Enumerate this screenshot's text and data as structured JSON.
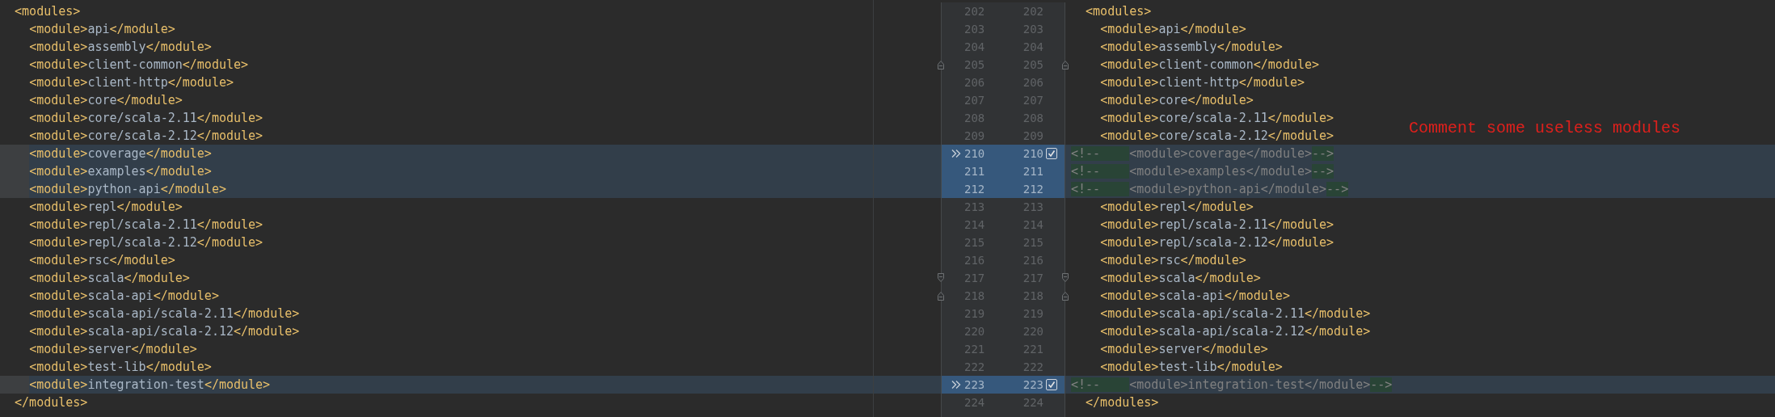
{
  "annotation": "Comment some useless modules",
  "lines": [
    {
      "left_number": "202",
      "right_number": "202",
      "left": "  <modules>",
      "right": "  <modules>",
      "changed": false
    },
    {
      "left_number": "203",
      "right_number": "203",
      "left": "    <module>api</module>",
      "right": "    <module>api</module>",
      "changed": false
    },
    {
      "left_number": "204",
      "right_number": "204",
      "left": "    <module>assembly</module>",
      "right": "    <module>assembly</module>",
      "changed": false
    },
    {
      "left_number": "205",
      "right_number": "205",
      "left": "    <module>client-common</module>",
      "right": "    <module>client-common</module>",
      "changed": false,
      "fold_start": true
    },
    {
      "left_number": "206",
      "right_number": "206",
      "left": "    <module>client-http</module>",
      "right": "    <module>client-http</module>",
      "changed": false
    },
    {
      "left_number": "207",
      "right_number": "207",
      "left": "    <module>core</module>",
      "right": "    <module>core</module>",
      "changed": false
    },
    {
      "left_number": "208",
      "right_number": "208",
      "left": "    <module>core/scala-2.11</module>",
      "right": "    <module>core/scala-2.11</module>",
      "changed": false
    },
    {
      "left_number": "209",
      "right_number": "209",
      "left": "    <module>core/scala-2.12</module>",
      "right": "    <module>core/scala-2.12</module>",
      "changed": false
    },
    {
      "left_number": "210",
      "right_number": "210",
      "left": "    <module>coverage</module>",
      "kind": "comment",
      "right": [
        {
          "text": "<!--    ",
          "inserted": true
        },
        {
          "text": "<module>coverage</module>",
          "inserted": false
        },
        {
          "text": "-->",
          "inserted": true
        }
      ],
      "changed": true,
      "apply_arrow": true,
      "include": {
        "checked": true
      }
    },
    {
      "left_number": "211",
      "right_number": "211",
      "left": "    <module>examples</module>",
      "kind": "comment",
      "right": [
        {
          "text": "<!--    ",
          "inserted": true
        },
        {
          "text": "<module>examples</module>",
          "inserted": false
        },
        {
          "text": "-->",
          "inserted": true
        }
      ],
      "changed": true
    },
    {
      "left_number": "212",
      "right_number": "212",
      "left": "    <module>python-api</module>",
      "kind": "comment",
      "right": [
        {
          "text": "<!--    ",
          "inserted": true
        },
        {
          "text": "<module>python-api</module>",
          "inserted": false
        },
        {
          "text": "-->",
          "inserted": true
        }
      ],
      "changed": true
    },
    {
      "left_number": "213",
      "right_number": "213",
      "left": "    <module>repl</module>",
      "right": "    <module>repl</module>",
      "changed": false
    },
    {
      "left_number": "214",
      "right_number": "214",
      "left": "    <module>repl/scala-2.11</module>",
      "right": "    <module>repl/scala-2.11</module>",
      "changed": false
    },
    {
      "left_number": "215",
      "right_number": "215",
      "left": "    <module>repl/scala-2.12</module>",
      "right": "    <module>repl/scala-2.12</module>",
      "changed": false
    },
    {
      "left_number": "216",
      "right_number": "216",
      "left": "    <module>rsc</module>",
      "right": "    <module>rsc</module>",
      "changed": false
    },
    {
      "left_number": "217",
      "right_number": "217",
      "left": "    <module>scala</module>",
      "right": "    <module>scala</module>",
      "changed": false,
      "fold_end": true
    },
    {
      "left_number": "218",
      "right_number": "218",
      "left": "    <module>scala-api</module>",
      "right": "    <module>scala-api</module>",
      "changed": false,
      "fold_start": true
    },
    {
      "left_number": "219",
      "right_number": "219",
      "left": "    <module>scala-api/scala-2.11</module>",
      "right": "    <module>scala-api/scala-2.11</module>",
      "changed": false
    },
    {
      "left_number": "220",
      "right_number": "220",
      "left": "    <module>scala-api/scala-2.12</module>",
      "right": "    <module>scala-api/scala-2.12</module>",
      "changed": false
    },
    {
      "left_number": "221",
      "right_number": "221",
      "left": "    <module>server</module>",
      "right": "    <module>server</module>",
      "changed": false
    },
    {
      "left_number": "222",
      "right_number": "222",
      "left": "    <module>test-lib</module>",
      "right": "    <module>test-lib</module>",
      "changed": false
    },
    {
      "left_number": "223",
      "right_number": "223",
      "left": "    <module>integration-test</module>",
      "kind": "comment",
      "right": [
        {
          "text": "<!--    ",
          "inserted": true
        },
        {
          "text": "<module>integration-test</module>",
          "inserted": false
        },
        {
          "text": "-->",
          "inserted": true
        }
      ],
      "changed": true,
      "apply_arrow": true,
      "include": {
        "checked": true
      }
    },
    {
      "left_number": "224",
      "right_number": "224",
      "left": "  </modules>",
      "right": "  </modules>",
      "changed": false
    }
  ]
}
